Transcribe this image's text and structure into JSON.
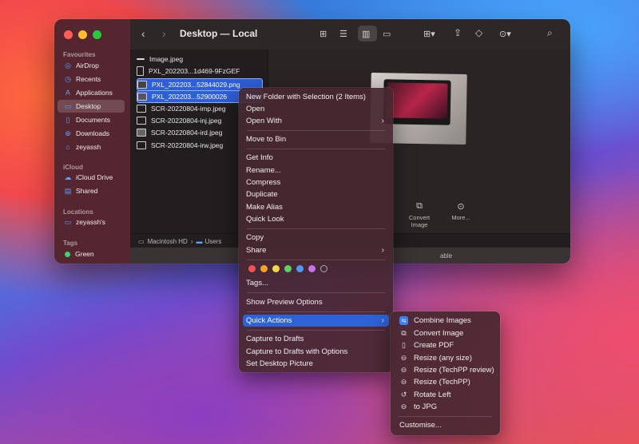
{
  "window": {
    "title": "Desktop — Local",
    "sidebar": {
      "sections": [
        {
          "label": "Favourites"
        },
        {
          "label": "iCloud"
        },
        {
          "label": "Locations"
        },
        {
          "label": "Tags"
        }
      ],
      "favourites": [
        {
          "label": "AirDrop",
          "icon": "airdrop-icon"
        },
        {
          "label": "Recents",
          "icon": "clock-icon"
        },
        {
          "label": "Applications",
          "icon": "applications-icon"
        },
        {
          "label": "Desktop",
          "icon": "desktop-icon",
          "active": true
        },
        {
          "label": "Documents",
          "icon": "document-icon"
        },
        {
          "label": "Downloads",
          "icon": "download-icon"
        },
        {
          "label": "zeyassh",
          "icon": "home-icon"
        }
      ],
      "icloud": [
        {
          "label": "iCloud Drive",
          "icon": "cloud-icon"
        },
        {
          "label": "Shared",
          "icon": "shared-folder-icon"
        }
      ],
      "locations": [
        {
          "label": "zeyassh's",
          "icon": "laptop-icon"
        }
      ],
      "tags": [
        {
          "label": "Green",
          "color": "#3ed36b"
        }
      ]
    },
    "files": [
      {
        "name": "Image.jpeg",
        "selected": false
      },
      {
        "name": "PXL_202203...1d469-9FzGEF",
        "selected": false
      },
      {
        "name": "PXL_202203...52844029.png",
        "selected": true
      },
      {
        "name": "PXL_202203...52900026",
        "selected": true
      },
      {
        "name": "SCR-20220804-imp.jpeg",
        "selected": false
      },
      {
        "name": "SCR-20220804-inj.jpeg",
        "selected": false
      },
      {
        "name": "SCR-20220804-ird.jpeg",
        "selected": false
      },
      {
        "name": "SCR-20220804-irw.jpeg",
        "selected": false
      }
    ],
    "preview_actions": [
      {
        "label": "Convert Image",
        "icon": "convert-image-icon"
      },
      {
        "label": "More...",
        "icon": "more-icon"
      }
    ],
    "path": [
      "Macintosh HD",
      "Users"
    ],
    "status_text": "able"
  },
  "context_menu": {
    "items": {
      "new_folder": "New Folder with Selection (2 Items)",
      "open": "Open",
      "open_with": "Open With",
      "move_to_bin": "Move to Bin",
      "get_info": "Get Info",
      "rename": "Rename...",
      "compress": "Compress",
      "duplicate": "Duplicate",
      "make_alias": "Make Alias",
      "quick_look": "Quick Look",
      "copy": "Copy",
      "share": "Share",
      "tags": "Tags...",
      "show_preview": "Show Preview Options",
      "quick_actions": "Quick Actions",
      "capture_drafts": "Capture to Drafts",
      "capture_drafts_options": "Capture to Drafts with Options",
      "set_desktop": "Set Desktop Picture"
    },
    "tag_colors": [
      "#f0544f",
      "#f5a623",
      "#f8d648",
      "#5fd068",
      "#4b9bf5",
      "#c274e8",
      "none"
    ]
  },
  "quick_actions_menu": {
    "items": [
      {
        "label": "Combine Images",
        "icon": "combine-images-icon"
      },
      {
        "label": "Convert Image",
        "icon": "convert-image-icon"
      },
      {
        "label": "Create PDF",
        "icon": "create-pdf-icon"
      },
      {
        "label": "Resize (any size)",
        "icon": "workflow-icon"
      },
      {
        "label": "Resize (TechPP review)",
        "icon": "workflow-icon"
      },
      {
        "label": "Resize (TechPP)",
        "icon": "workflow-icon"
      },
      {
        "label": "Rotate Left",
        "icon": "rotate-left-icon"
      },
      {
        "label": "to JPG",
        "icon": "workflow-icon"
      }
    ],
    "customise": "Customise..."
  }
}
